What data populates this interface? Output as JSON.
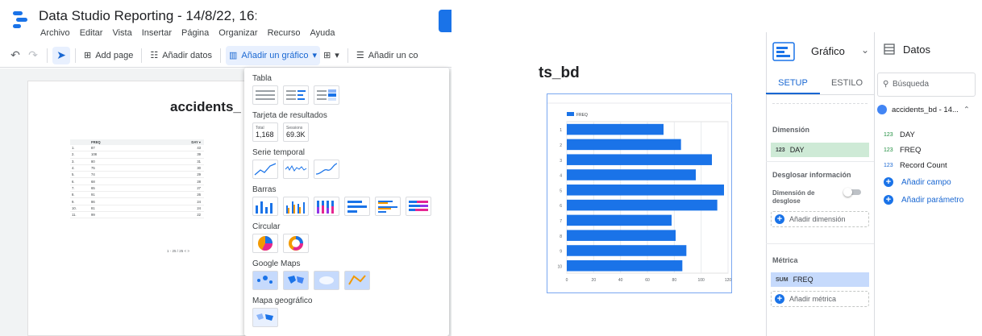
{
  "app": {
    "title": "Data Studio Reporting - 14/8/22, 16:0ć",
    "menu": [
      "Archivo",
      "Editar",
      "Vista",
      "Insertar",
      "Página",
      "Organizar",
      "Recurso",
      "Ayuda"
    ]
  },
  "toolbar": {
    "add_page": "Add page",
    "add_data": "Añadir datos",
    "add_chart": "Añadir un gráfico",
    "add_control": "Añadir un co"
  },
  "report": {
    "title": "accidents_",
    "right_title": "ts_bd"
  },
  "mini_table": {
    "headers": [
      "FREQ",
      "DAY ▾"
    ],
    "rows": [
      [
        "1.",
        "87",
        "43"
      ],
      [
        "2.",
        "108",
        "39"
      ],
      [
        "3.",
        "80",
        "31"
      ],
      [
        "4.",
        "75",
        "30"
      ],
      [
        "5.",
        "74",
        "29"
      ],
      [
        "6.",
        "68",
        "28"
      ],
      [
        "7.",
        "65",
        "27"
      ],
      [
        "8.",
        "91",
        "26"
      ],
      [
        "9.",
        "86",
        "24"
      ],
      [
        "10.",
        "81",
        "24"
      ],
      [
        "11.",
        "99",
        "22"
      ]
    ],
    "pager": "1 - 25 / 25   <   >"
  },
  "dropdown": {
    "sections": [
      "Tabla",
      "Tarjeta de resultados",
      "Serie temporal",
      "Barras",
      "Circular",
      "Google Maps",
      "Mapa geográfico"
    ],
    "scorecards": [
      {
        "label": "Total",
        "value": "1,168"
      },
      {
        "label": "Sessions",
        "value": "69.3K"
      }
    ]
  },
  "chart_data": {
    "type": "bar",
    "orientation": "horizontal",
    "legend": [
      "FREQ"
    ],
    "categories": [
      "1",
      "2",
      "3",
      "4",
      "5",
      "6",
      "7",
      "8",
      "9",
      "10"
    ],
    "values": [
      72,
      85,
      108,
      96,
      117,
      112,
      78,
      81,
      89,
      86
    ],
    "xlim": [
      0,
      120
    ],
    "xticks": [
      "0",
      "20",
      "40",
      "60",
      "80",
      "100",
      "120"
    ],
    "grid": true,
    "bar_color": "#1a73e8"
  },
  "setup": {
    "panel_name": "Gráfico",
    "tabs": [
      "SETUP",
      "ESTILO"
    ],
    "dimension_label": "Dimensión",
    "dimension": {
      "type": "123",
      "name": "DAY"
    },
    "breakdown_label": "Desglosar información",
    "breakdown_dim_label": "Dimensión de desglose",
    "add_dimension": "Añadir dimensión",
    "metric_label": "Métrica",
    "metric": {
      "type": "SUM",
      "name": "FREQ"
    },
    "add_metric": "Añadir métrica"
  },
  "data_panel": {
    "title": "Datos",
    "search_placeholder": "Búsqueda",
    "source": "accidents_bd - 14...",
    "fields": [
      {
        "type": "123",
        "name": "DAY"
      },
      {
        "type": "123",
        "name": "FREQ"
      },
      {
        "type": "123",
        "name": "Record Count"
      }
    ],
    "add_field": "Añadir campo",
    "add_param": "Añadir parámetro"
  }
}
